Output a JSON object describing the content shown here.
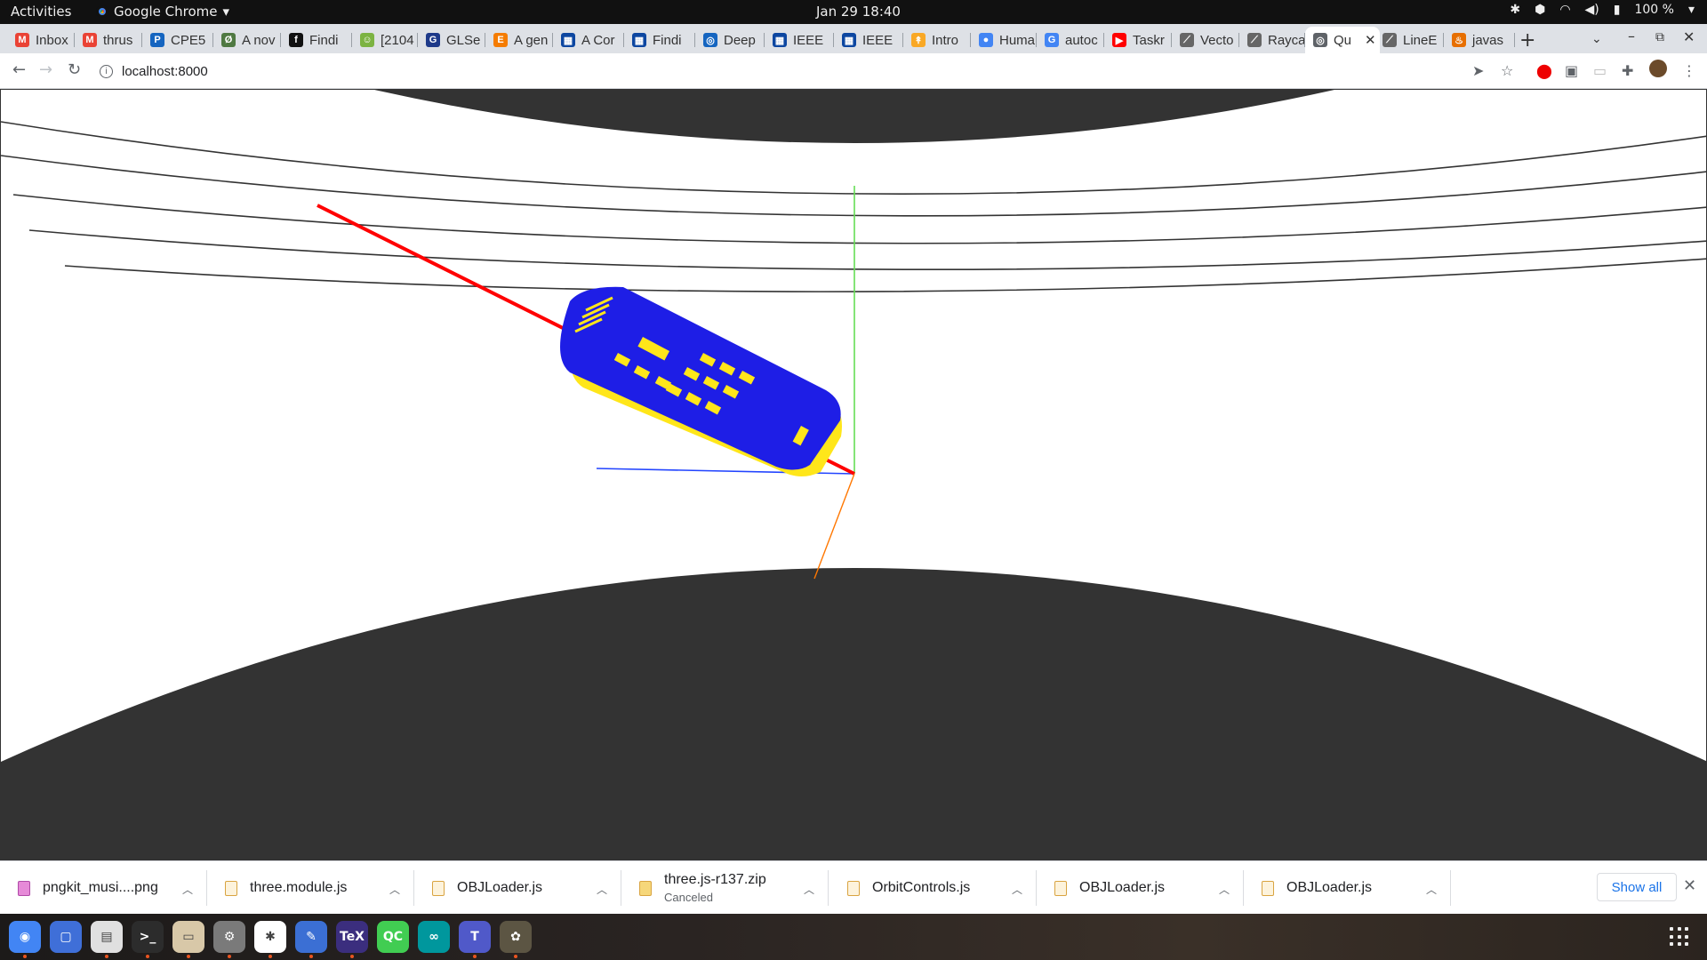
{
  "topbar": {
    "activities": "Activities",
    "app_name": "Google Chrome",
    "clock": "Jan 29  18:40",
    "battery": "100 %"
  },
  "tabs": [
    {
      "label": "Inbox",
      "icon": "gmail-icon",
      "color": "#ea4335",
      "glyph": "M"
    },
    {
      "label": "thrus",
      "icon": "gmail-icon",
      "color": "#ea4335",
      "glyph": "M"
    },
    {
      "label": "CPE5",
      "icon": "p-icon",
      "color": "#1565c0",
      "glyph": "P"
    },
    {
      "label": "A nov",
      "icon": "overleaf-icon",
      "color": "#4f7942",
      "glyph": "Ø"
    },
    {
      "label": "Findi",
      "icon": "findit-icon",
      "color": "#111111",
      "glyph": "f"
    },
    {
      "label": "[2104",
      "icon": "smiley-icon",
      "color": "#7cb342",
      "glyph": "☺"
    },
    {
      "label": "GLSe",
      "icon": "gl-icon",
      "color": "#1e3a8a",
      "glyph": "G"
    },
    {
      "label": "A gen",
      "icon": "e-icon",
      "color": "#f57c00",
      "glyph": "E"
    },
    {
      "label": "A Cor",
      "icon": "ieee-icon",
      "color": "#0d47a1",
      "glyph": "▦"
    },
    {
      "label": "Findi",
      "icon": "ieee-icon",
      "color": "#0d47a1",
      "glyph": "▦"
    },
    {
      "label": "Deep",
      "icon": "globe-icon",
      "color": "#1565c0",
      "glyph": "◎"
    },
    {
      "label": "IEEE",
      "icon": "ieee-icon",
      "color": "#0d47a1",
      "glyph": "▦"
    },
    {
      "label": "IEEE",
      "icon": "ieee-icon",
      "color": "#0d47a1",
      "glyph": "▦"
    },
    {
      "label": "Intro",
      "icon": "hf-icon",
      "color": "#f9a825",
      "glyph": "↟"
    },
    {
      "label": "Huma",
      "icon": "circle-icon",
      "color": "#4285f4",
      "glyph": "●"
    },
    {
      "label": "autoc",
      "icon": "google-icon",
      "color": "#4285f4",
      "glyph": "G"
    },
    {
      "label": "Taskr",
      "icon": "youtube-icon",
      "color": "#ff0000",
      "glyph": "▶"
    },
    {
      "label": "Vecto",
      "icon": "raycast-icon",
      "color": "#666666",
      "glyph": "⟋"
    },
    {
      "label": "Rayca",
      "icon": "raycast-icon",
      "color": "#666666",
      "glyph": "⟋"
    },
    {
      "label": "Qu",
      "icon": "globe-icon",
      "color": "#5f6368",
      "glyph": "◎",
      "active": true
    },
    {
      "label": "LineE",
      "icon": "raycast-icon",
      "color": "#666666",
      "glyph": "⟋"
    },
    {
      "label": "javas",
      "icon": "java-icon",
      "color": "#e76f00",
      "glyph": "♨"
    }
  ],
  "address_bar": {
    "url": "localhost:8000"
  },
  "downloads": [
    {
      "name": "pngkit_musi....png",
      "type": "png",
      "status": ""
    },
    {
      "name": "three.module.js",
      "type": "js",
      "status": ""
    },
    {
      "name": "OBJLoader.js",
      "type": "js",
      "status": ""
    },
    {
      "name": "three.js-r137.zip",
      "type": "zip",
      "status": "Canceled"
    },
    {
      "name": "OrbitControls.js",
      "type": "js",
      "status": ""
    },
    {
      "name": "OBJLoader.js",
      "type": "js",
      "status": ""
    },
    {
      "name": "OBJLoader.js",
      "type": "js",
      "status": ""
    }
  ],
  "show_all": "Show all",
  "scene_colors": {
    "ground": "#333333",
    "model_body": "#1e1ee6",
    "model_buttons": "#ffe61a",
    "axis_x": "#ff0000",
    "axis_y": "#66dd55",
    "axis_z": "#2244ff",
    "axis_extra": "#ff7700"
  },
  "dock_apps": [
    {
      "name": "chrome-app-icon",
      "color": "#4285f4",
      "glyph": "◉",
      "running": true
    },
    {
      "name": "screenshot-app-icon",
      "color": "#3f6fd8",
      "glyph": "▢",
      "running": false
    },
    {
      "name": "document-viewer-app-icon",
      "color": "#e0e0e0",
      "glyph": "▤",
      "running": true
    },
    {
      "name": "terminal-app-icon",
      "color": "#2c2c2c",
      "glyph": ">_",
      "running": true
    },
    {
      "name": "files-app-icon",
      "color": "#d8c8a8",
      "glyph": "▭",
      "running": true
    },
    {
      "name": "settings-app-icon",
      "color": "#7a7a7a",
      "glyph": "⚙",
      "running": true
    },
    {
      "name": "slack-app-icon",
      "color": "#ffffff",
      "glyph": "✱",
      "running": true
    },
    {
      "name": "text-editor-app-icon",
      "color": "#3b6fd4",
      "glyph": "✎",
      "running": true
    },
    {
      "name": "texstudio-app-icon",
      "color": "#3b2e7e",
      "glyph": "TeX",
      "running": true
    },
    {
      "name": "qtcreator-app-icon",
      "color": "#41cd52",
      "glyph": "QC",
      "running": false
    },
    {
      "name": "arduino-app-icon",
      "color": "#00979d",
      "glyph": "∞",
      "running": false
    },
    {
      "name": "teams-app-icon",
      "color": "#5059c9",
      "glyph": "T",
      "running": true
    },
    {
      "name": "gimp-app-icon",
      "color": "#5c5543",
      "glyph": "✿",
      "running": true
    }
  ]
}
